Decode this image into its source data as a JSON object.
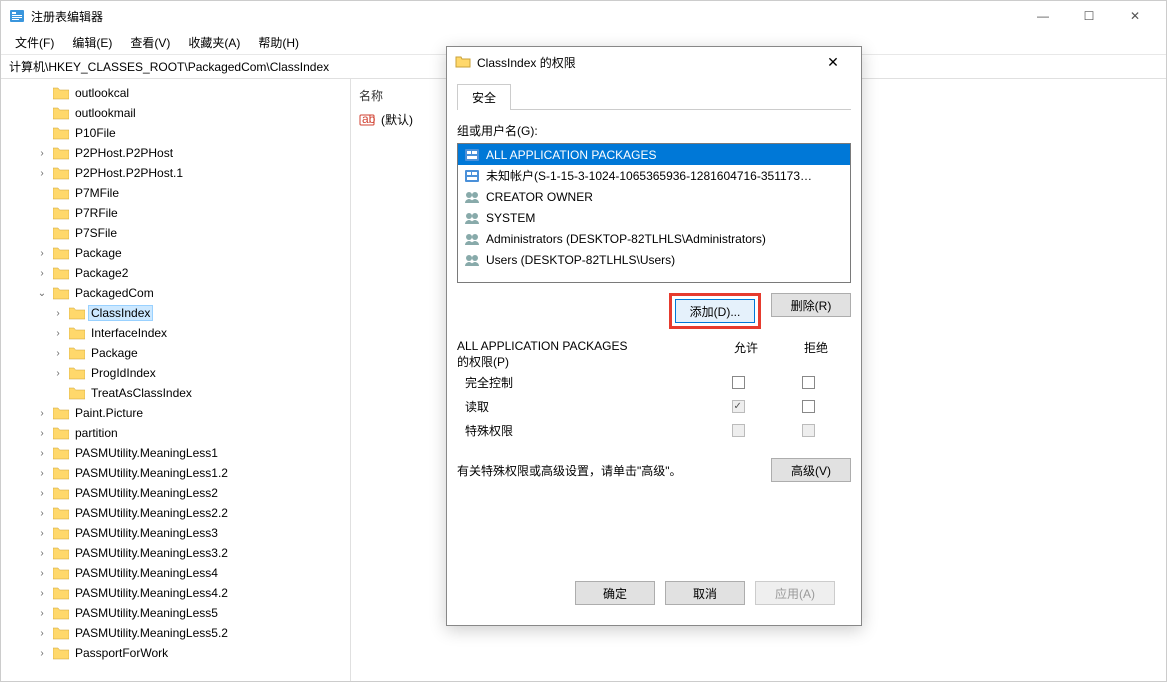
{
  "window": {
    "title": "注册表编辑器",
    "controls": {
      "min": "—",
      "max": "☐",
      "close": "✕"
    }
  },
  "menu": {
    "file": "文件(F)",
    "edit": "编辑(E)",
    "view": "查看(V)",
    "fav": "收藏夹(A)",
    "help": "帮助(H)"
  },
  "address": "计算机\\HKEY_CLASSES_ROOT\\PackagedCom\\ClassIndex",
  "tree": [
    {
      "d": 2,
      "exp": "",
      "label": "outlookcal"
    },
    {
      "d": 2,
      "exp": "",
      "label": "outlookmail"
    },
    {
      "d": 2,
      "exp": "",
      "label": "P10File"
    },
    {
      "d": 2,
      "exp": ">",
      "label": "P2PHost.P2PHost"
    },
    {
      "d": 2,
      "exp": ">",
      "label": "P2PHost.P2PHost.1"
    },
    {
      "d": 2,
      "exp": "",
      "label": "P7MFile"
    },
    {
      "d": 2,
      "exp": "",
      "label": "P7RFile"
    },
    {
      "d": 2,
      "exp": "",
      "label": "P7SFile"
    },
    {
      "d": 2,
      "exp": ">",
      "label": "Package"
    },
    {
      "d": 2,
      "exp": ">",
      "label": "Package2"
    },
    {
      "d": 2,
      "exp": "v",
      "label": "PackagedCom"
    },
    {
      "d": 3,
      "exp": ">",
      "label": "ClassIndex",
      "sel": true
    },
    {
      "d": 3,
      "exp": ">",
      "label": "InterfaceIndex"
    },
    {
      "d": 3,
      "exp": ">",
      "label": "Package"
    },
    {
      "d": 3,
      "exp": ">",
      "label": "ProgIdIndex"
    },
    {
      "d": 3,
      "exp": "",
      "label": "TreatAsClassIndex"
    },
    {
      "d": 2,
      "exp": ">",
      "label": "Paint.Picture"
    },
    {
      "d": 2,
      "exp": ">",
      "label": "partition"
    },
    {
      "d": 2,
      "exp": ">",
      "label": "PASMUtility.MeaningLess1"
    },
    {
      "d": 2,
      "exp": ">",
      "label": "PASMUtility.MeaningLess1.2"
    },
    {
      "d": 2,
      "exp": ">",
      "label": "PASMUtility.MeaningLess2"
    },
    {
      "d": 2,
      "exp": ">",
      "label": "PASMUtility.MeaningLess2.2"
    },
    {
      "d": 2,
      "exp": ">",
      "label": "PASMUtility.MeaningLess3"
    },
    {
      "d": 2,
      "exp": ">",
      "label": "PASMUtility.MeaningLess3.2"
    },
    {
      "d": 2,
      "exp": ">",
      "label": "PASMUtility.MeaningLess4"
    },
    {
      "d": 2,
      "exp": ">",
      "label": "PASMUtility.MeaningLess4.2"
    },
    {
      "d": 2,
      "exp": ">",
      "label": "PASMUtility.MeaningLess5"
    },
    {
      "d": 2,
      "exp": ">",
      "label": "PASMUtility.MeaningLess5.2"
    },
    {
      "d": 2,
      "exp": ">",
      "label": "PassportForWork"
    }
  ],
  "list": {
    "header_name": "名称",
    "default_value": "(默认)"
  },
  "dialog": {
    "title": "ClassIndex 的权限",
    "tab": "安全",
    "groups_label": "组或用户名(G):",
    "groups": [
      {
        "icon": "pkg",
        "name": "ALL APPLICATION PACKAGES",
        "sel": true
      },
      {
        "icon": "pkg",
        "name": "未知帐户(S-1-15-3-1024-1065365936-1281604716-351173…"
      },
      {
        "icon": "grp",
        "name": "CREATOR OWNER"
      },
      {
        "icon": "grp",
        "name": "SYSTEM"
      },
      {
        "icon": "grp",
        "name": "Administrators (DESKTOP-82TLHLS\\Administrators)"
      },
      {
        "icon": "grp",
        "name": "Users (DESKTOP-82TLHLS\\Users)"
      }
    ],
    "add_btn": "添加(D)...",
    "remove_btn": "删除(R)",
    "perm_title_1": "ALL APPLICATION PACKAGES",
    "perm_title_2": "的权限(P)",
    "col_allow": "允许",
    "col_deny": "拒绝",
    "perms": [
      {
        "name": "完全控制",
        "allow": "",
        "deny": ""
      },
      {
        "name": "读取",
        "allow": "checked-disabled",
        "deny": ""
      },
      {
        "name": "特殊权限",
        "allow": "disabled",
        "deny": "disabled"
      }
    ],
    "adv_text": "有关特殊权限或高级设置，请单击\"高级\"。",
    "adv_btn": "高级(V)",
    "ok": "确定",
    "cancel": "取消",
    "apply": "应用(A)"
  }
}
